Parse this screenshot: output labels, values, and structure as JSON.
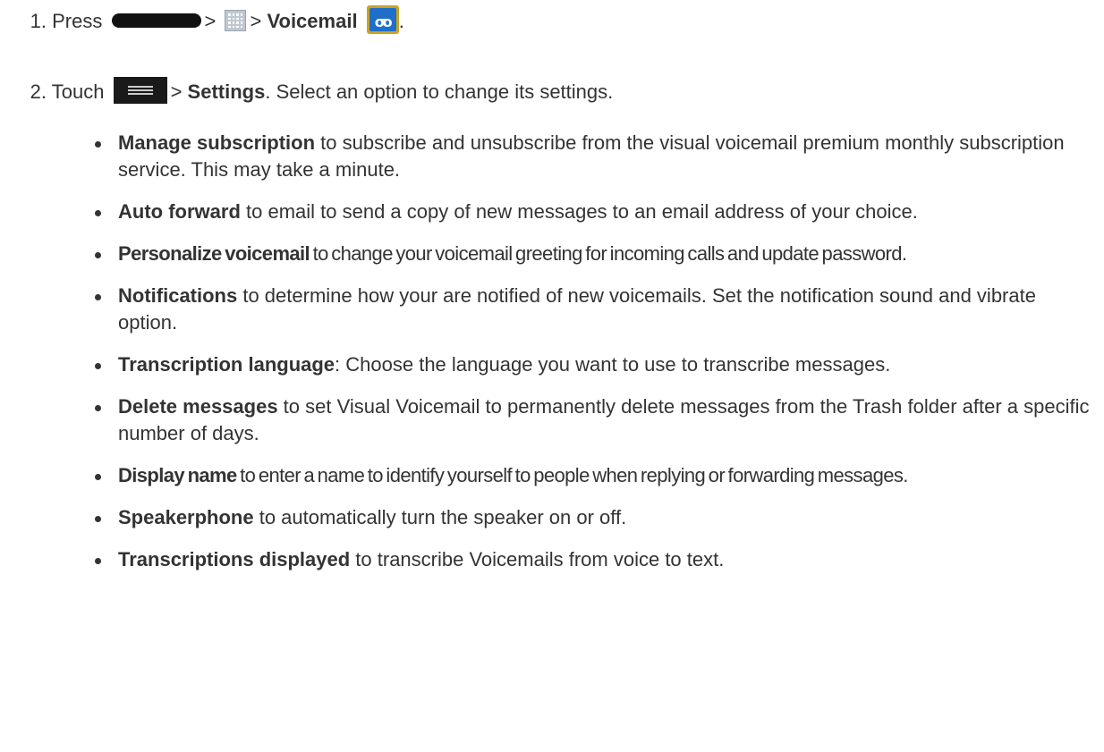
{
  "steps": [
    {
      "num": "1.",
      "press": "Press",
      "sep1": ">",
      "sep2": ">",
      "voicemail": "Voicemail",
      "end": ".",
      "icons": [
        "home-key-icon",
        "apps-grid-icon",
        "voicemail-app-icon"
      ]
    },
    {
      "num": "2.",
      "touch": "Touch",
      "sep": ">",
      "settings": "Settings",
      "rest": ". Select an option to change its settings.",
      "icons": [
        "menu-key-icon"
      ]
    }
  ],
  "options": [
    {
      "term": "Manage subscription",
      "desc": " to subscribe and unsubscribe from the visual voicemail premium monthly subscription service. This may take a minute."
    },
    {
      "term": "Auto forward",
      "desc": " to email to send a copy of new messages to an email address of your choice."
    },
    {
      "term": "Personalize voicemail",
      "desc": " to change your voicemail greeting for incoming calls and update password."
    },
    {
      "term": "Notifications",
      "desc": " to determine how your are notified of new voicemails. Set the notification sound and vibrate option."
    },
    {
      "term": "Transcription language",
      "desc": ": Choose the language you want to use to transcribe messages."
    },
    {
      "term": "Delete messages",
      "desc": " to set Visual Voicemail to permanently delete messages from the Trash folder after a specific number of days."
    },
    {
      "term": "Display name",
      "desc": " to enter a name to identify yourself to people when replying or forwarding messages."
    },
    {
      "term": "Speakerphone",
      "desc": " to automatically turn the speaker on or off."
    },
    {
      "term": "Transcriptions displayed",
      "desc": " to transcribe Voicemails from voice to text."
    }
  ]
}
